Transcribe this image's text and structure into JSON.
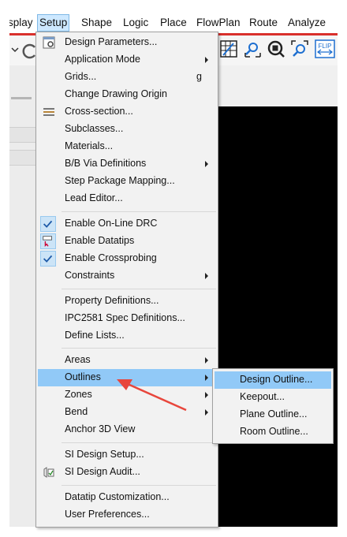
{
  "menubar": {
    "items": [
      "splay",
      "Setup",
      "Shape",
      "Logic",
      "Place",
      "FlowPlan",
      "Route",
      "Analyze"
    ],
    "active": "Setup"
  },
  "colors": {
    "accent_line": "#d9302c",
    "highlight": "#91c9f7",
    "check_bg": "#cce4f7",
    "annotation_arrow": "#e8463c"
  },
  "toolbar": {
    "icons": [
      "grid-icon",
      "zoom-in-icon",
      "zoom-fit-icon",
      "zoom-out-icon",
      "flip-icon"
    ],
    "flip_label": "FLIP"
  },
  "setup_menu": {
    "items": [
      {
        "label": "Design Parameters...",
        "icon": "design-parameters-icon"
      },
      {
        "label": "Application Mode",
        "submenu": true
      },
      {
        "label": "Grids...",
        "accel": "g"
      },
      {
        "label": "Change Drawing Origin"
      },
      {
        "label": "Cross-section...",
        "icon": "cross-section-icon"
      },
      {
        "label": "Subclasses..."
      },
      {
        "label": "Materials..."
      },
      {
        "label": "B/B Via Definitions",
        "submenu": true
      },
      {
        "label": "Step Package Mapping..."
      },
      {
        "label": "Lead Editor..."
      },
      {
        "label": "Enable On-Line DRC",
        "checked": true
      },
      {
        "label": "Enable Datatips",
        "icon": "datatips-icon"
      },
      {
        "label": "Enable Crossprobing",
        "checked": true
      },
      {
        "label": "Constraints",
        "submenu": true
      },
      {
        "label": "Property Definitions..."
      },
      {
        "label": "IPC2581 Spec Definitions..."
      },
      {
        "label": "Define Lists..."
      },
      {
        "label": "Areas",
        "submenu": true
      },
      {
        "label": "Outlines",
        "submenu": true,
        "highlighted": true
      },
      {
        "label": "Zones",
        "submenu": true
      },
      {
        "label": "Bend",
        "submenu": true
      },
      {
        "label": "Anchor 3D View"
      },
      {
        "label": "SI Design Setup..."
      },
      {
        "label": "SI Design Audit...",
        "icon": "si-audit-icon"
      },
      {
        "label": "Datatip Customization..."
      },
      {
        "label": "User Preferences..."
      }
    ]
  },
  "outlines_submenu": {
    "items": [
      {
        "label": "Design Outline...",
        "highlighted": true
      },
      {
        "label": "Keepout..."
      },
      {
        "label": "Plane Outline..."
      },
      {
        "label": "Room Outline..."
      }
    ]
  }
}
